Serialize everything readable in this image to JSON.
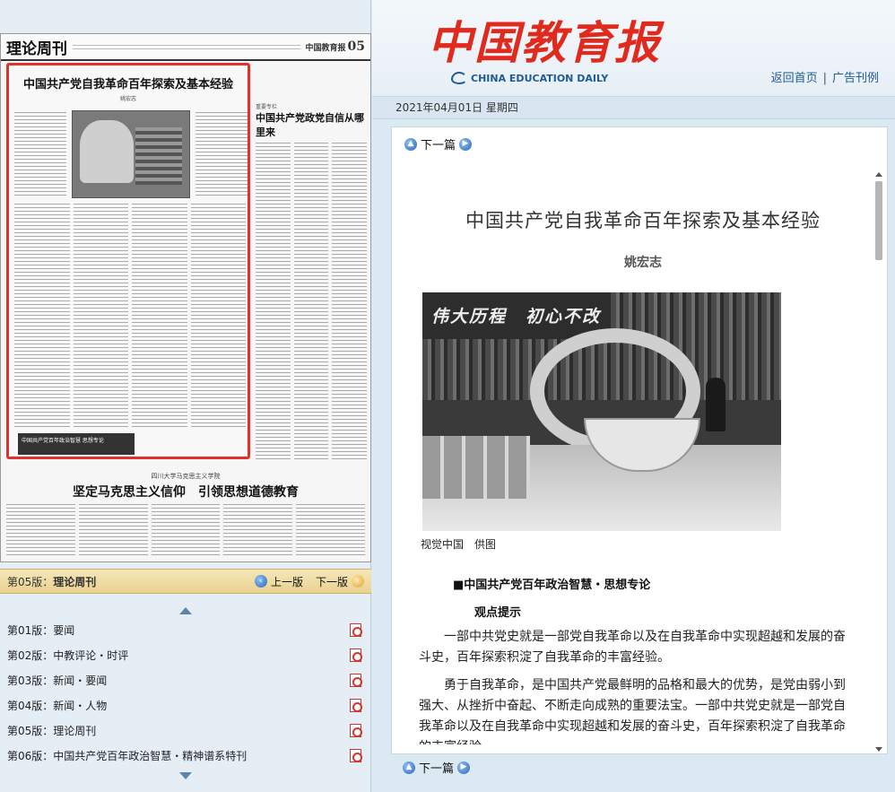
{
  "window": {
    "title": "中国教育报"
  },
  "masthead": {
    "logo_cn": "中国教育报",
    "logo_en": "CHINA EDUCATION DAILY"
  },
  "toplinks": {
    "home": "返回首页",
    "sep": "|",
    "ad": "广告刊例"
  },
  "date_bar": {
    "text": "2021年04月01日 星期四"
  },
  "newspaper_thumb": {
    "section": "理论周刊",
    "page_no": "05",
    "paper_name": "中国教育报",
    "main_title": "中国共产党自我革命百年探索及基本经验",
    "author": "姚宏志",
    "side_label": "重要专栏",
    "side_title": "中国共产党政党自信从哪里来",
    "badge": "中国共产党百年政治智慧 思想专论",
    "bottom_sup": "四川大学马克思主义学院",
    "bottom_title": "坚定马克思主义信仰　引领思想道德教育"
  },
  "version_bar": {
    "current_prefix": "第05版：",
    "current_name": "理论周刊",
    "prev": "上一版",
    "next": "下一版"
  },
  "page_list": [
    {
      "label": "第01版：要闻"
    },
    {
      "label": "第02版：中教评论・时评"
    },
    {
      "label": "第03版：新闻・要闻"
    },
    {
      "label": "第04版：新闻・人物"
    },
    {
      "label": "第05版：理论周刊"
    },
    {
      "label": "第06版：中国共产党百年政治智慧・精神谱系特刊"
    }
  ],
  "article": {
    "next_label": "下一篇",
    "title": "中国共产党自我革命百年探索及基本经验",
    "author": "姚宏志",
    "photo_banner": "伟大历程　初心不改",
    "photo_caption": "视觉中国　供图",
    "subhead": "■中国共产党百年政治智慧・思想专论",
    "tip": "观点提示",
    "paragraphs": [
      "一部中共党史就是一部党自我革命以及在自我革命中实现超越和发展的奋斗史，百年探索积淀了自我革命的丰富经验。",
      "勇于自我革命，是中国共产党最鲜明的品格和最大的优势，是党由弱小到强大、从挫折中奋起、不断走向成熟的重要法宝。一部中共党史就是一部党自我革命以及在自我革命中实现超越和发展的奋斗史，百年探索积淀了自我革命的丰富经验。"
    ]
  },
  "colors": {
    "logo_red": "#e02a1e",
    "link_blue": "#1f5c94",
    "highlight_red": "#e0312b",
    "bar_gold": "#e9d28f"
  }
}
